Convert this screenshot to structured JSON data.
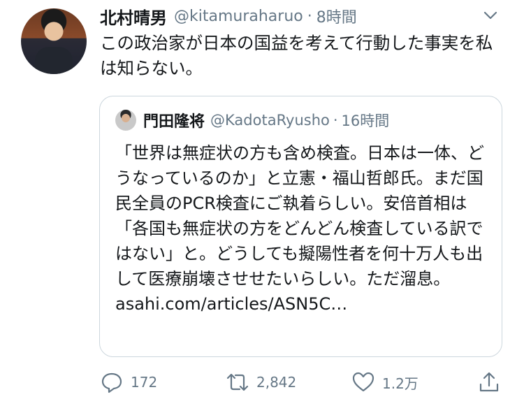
{
  "tweet": {
    "author_name": "北村晴男",
    "author_handle": "@kitamuraharuo",
    "separator": "·",
    "time": "8時間",
    "text": "この政治家が日本の国益を考えて行動した事実を私は知らない。"
  },
  "quote": {
    "author_name": "門田隆将",
    "author_handle": "@KadotaRyusho",
    "separator": "·",
    "time": "16時間",
    "text": "「世界は無症状の方も含め検査。日本は一体、どうなっているのか」と立憲・福山哲郎氏。まだ国民全員のPCR検査にご執着らしい。安倍首相は「各国も無症状の方をどんどん検査している訳ではない」と。どうしても擬陽性者を何十万人も出して医療崩壊させせたいらしい。ただ溜息。",
    "link": "asahi.com/articles/ASN5C…"
  },
  "actions": {
    "reply_count": "172",
    "retweet_count": "2,842",
    "like_count": "1.2万"
  },
  "icons": {
    "more": "chevron-down-icon",
    "reply": "reply-icon",
    "retweet": "retweet-icon",
    "like": "heart-icon",
    "share": "share-icon"
  },
  "colors": {
    "text": "#14171a",
    "secondary": "#657786",
    "border": "#ccd6dd"
  }
}
